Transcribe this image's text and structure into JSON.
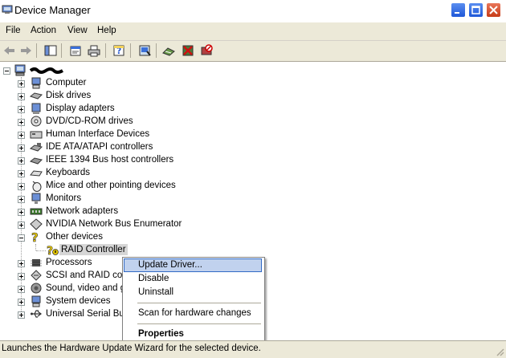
{
  "window": {
    "title": "Device Manager"
  },
  "menu": [
    "File",
    "Action",
    "View",
    "Help"
  ],
  "toolbar": {
    "icons": [
      "back-arrow-icon",
      "forward-arrow-icon",
      "show-hide-tree-icon",
      "properties-icon",
      "print-icon",
      "help-icon",
      "scan-hardware-icon",
      "update-driver-icon",
      "uninstall-icon",
      "disable-icon"
    ]
  },
  "tree": {
    "root_label": "",
    "nodes": [
      {
        "label": "Computer",
        "expanded": false
      },
      {
        "label": "Disk drives",
        "expanded": false
      },
      {
        "label": "Display adapters",
        "expanded": false
      },
      {
        "label": "DVD/CD-ROM drives",
        "expanded": false
      },
      {
        "label": "Human Interface Devices",
        "expanded": false
      },
      {
        "label": "IDE ATA/ATAPI controllers",
        "expanded": false
      },
      {
        "label": "IEEE 1394 Bus host controllers",
        "expanded": false
      },
      {
        "label": "Keyboards",
        "expanded": false
      },
      {
        "label": "Mice and other pointing devices",
        "expanded": false
      },
      {
        "label": "Monitors",
        "expanded": false
      },
      {
        "label": "Network adapters",
        "expanded": false
      },
      {
        "label": "NVIDIA Network Bus Enumerator",
        "expanded": false
      },
      {
        "label": "Other devices",
        "expanded": true
      },
      {
        "label": "RAID Controller",
        "child": true,
        "selected": true
      },
      {
        "label": "Processors",
        "expanded": false
      },
      {
        "label": "SCSI and RAID cont",
        "expanded": false
      },
      {
        "label": "Sound, video and ga",
        "expanded": false
      },
      {
        "label": "System devices",
        "expanded": false
      },
      {
        "label": "Universal Serial Bus",
        "expanded": false
      }
    ]
  },
  "context_menu": {
    "items": [
      "Update Driver...",
      "Disable",
      "Uninstall",
      "Scan for hardware changes",
      "Properties"
    ]
  },
  "status_bar": {
    "text": "Launches the Hardware Update Wizard for the selected device."
  },
  "colors": {
    "titlebar_blue": "#2a63d8",
    "menu_bg": "#ece9d8",
    "highlight": "#c1d2ee",
    "highlight_border": "#316ac5",
    "selected_item_bg": "#d6d6d6"
  }
}
